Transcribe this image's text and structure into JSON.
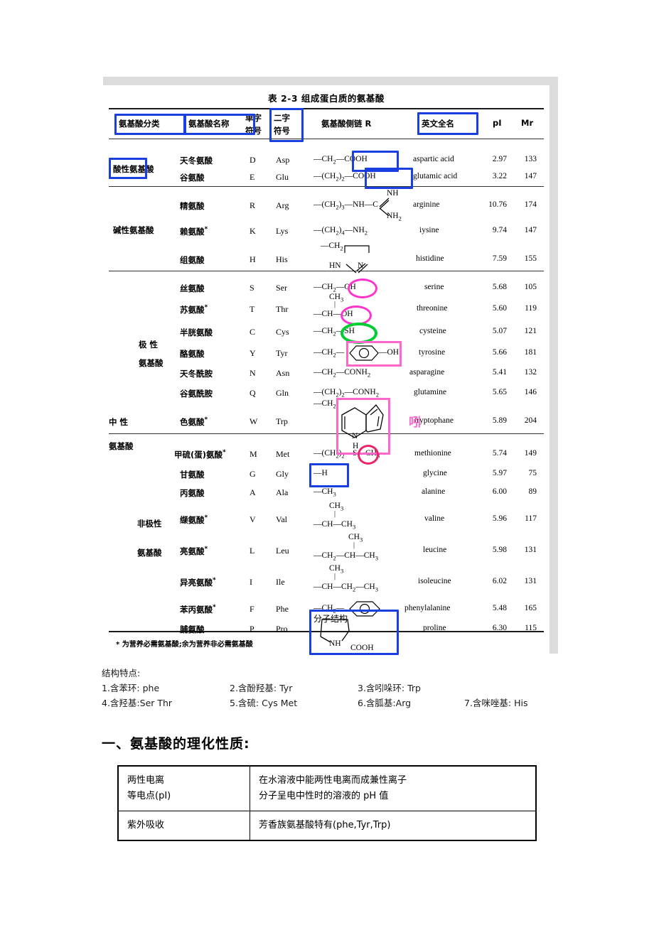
{
  "scan_table": {
    "title": "表 2-3   组成蛋白质的氨基酸",
    "headers": {
      "classification": "氨基酸分类",
      "name": "氨基酸名称",
      "one_letter_l1": "单字",
      "one_letter_l2": "符号",
      "three_letter_l1": "二字",
      "three_letter_l2": "符号",
      "side_chain": "氨基酸侧链 R",
      "english_name": "英文全名",
      "pi": "pI",
      "mr": "Mr"
    },
    "groups": {
      "acidic": "酸性氨基酸",
      "basic": "碱性氨基酸",
      "polar_l1": "极  性",
      "polar_l2": "氨基酸",
      "neutral_l1": "中  性",
      "neutral_l2": "氨基酸",
      "nonpolar_l1": "非极性",
      "nonpolar_l2": "氨基酸"
    },
    "rows": [
      {
        "name": "天冬氨酸",
        "essential": false,
        "one": "D",
        "three": "Asp",
        "english": "aspartic acid",
        "pi": "2.97",
        "mr": "133"
      },
      {
        "name": "谷氨酸",
        "essential": false,
        "one": "E",
        "three": "Glu",
        "english": "glutamic acid",
        "pi": "3.22",
        "mr": "147"
      },
      {
        "name": "精氨酸",
        "essential": false,
        "one": "R",
        "three": "Arg",
        "english": "arginine",
        "pi": "10.76",
        "mr": "174"
      },
      {
        "name": "赖氨酸",
        "essential": true,
        "one": "K",
        "three": "Lys",
        "english": "iysine",
        "pi": "9.74",
        "mr": "147"
      },
      {
        "name": "组氨酸",
        "essential": false,
        "one": "H",
        "three": "His",
        "english": "histidine",
        "pi": "7.59",
        "mr": "155"
      },
      {
        "name": "丝氨酸",
        "essential": false,
        "one": "S",
        "three": "Ser",
        "english": "serine",
        "pi": "5.68",
        "mr": "105"
      },
      {
        "name": "苏氨酸",
        "essential": true,
        "one": "T",
        "three": "Thr",
        "english": "threonine",
        "pi": "5.60",
        "mr": "119"
      },
      {
        "name": "半胱氨酸",
        "essential": false,
        "one": "C",
        "three": "Cys",
        "english": "cysteine",
        "pi": "5.07",
        "mr": "121"
      },
      {
        "name": "酪氨酸",
        "essential": false,
        "one": "Y",
        "three": "Tyr",
        "english": "tyrosine",
        "pi": "5.66",
        "mr": "181"
      },
      {
        "name": "天冬酰胺",
        "essential": false,
        "one": "N",
        "three": "Asn",
        "english": "asparagine",
        "pi": "5.41",
        "mr": "132"
      },
      {
        "name": "谷氨酰胺",
        "essential": false,
        "one": "Q",
        "three": "Gln",
        "english": "glutamine",
        "pi": "5.65",
        "mr": "146"
      },
      {
        "name": "色氨酸",
        "essential": true,
        "one": "W",
        "three": "Trp",
        "english": "tryptophane",
        "pi": "5.89",
        "mr": "204"
      },
      {
        "name": "甲硫(蛋)氨酸",
        "essential": true,
        "one": "M",
        "three": "Met",
        "english": "methionine",
        "pi": "5.74",
        "mr": "149"
      },
      {
        "name": "甘氨酸",
        "essential": false,
        "one": "G",
        "three": "Gly",
        "english": "glycine",
        "pi": "5.97",
        "mr": "75"
      },
      {
        "name": "丙氨酸",
        "essential": false,
        "one": "A",
        "three": "Ala",
        "english": "alanine",
        "pi": "6.00",
        "mr": "89"
      },
      {
        "name": "缬氨酸",
        "essential": true,
        "one": "V",
        "three": "Val",
        "english": "valine",
        "pi": "5.96",
        "mr": "117"
      },
      {
        "name": "亮氨酸",
        "essential": true,
        "one": "L",
        "three": "Leu",
        "english": "leucine",
        "pi": "5.98",
        "mr": "131"
      },
      {
        "name": "异亮氨酸",
        "essential": true,
        "one": "I",
        "three": "Ile",
        "english": "isoleucine",
        "pi": "6.02",
        "mr": "131"
      },
      {
        "name": "苯丙氨酸",
        "essential": true,
        "one": "F",
        "three": "Phe",
        "english": "phenylalanine",
        "pi": "5.48",
        "mr": "165"
      },
      {
        "name": "脯氨酸",
        "essential": false,
        "one": "P",
        "three": "Pro",
        "english": "proline",
        "pi": "6.30",
        "mr": "115"
      }
    ],
    "footnote": "* 为营养必需氨基酸;余为营养非必需氨基酸",
    "annotations": {
      "tryptophan_mark": "吲",
      "proline_box_label": "分子结构",
      "colors": {
        "blue_box": "#1a3fe0",
        "pink_box": "#ff66cc",
        "pink_ellipse": "#ff33cc",
        "green_ellipse": "#00cc33",
        "red_ellipse": "#e8256c"
      }
    }
  },
  "structure_notes": {
    "heading": "结构特点:",
    "items": [
      "1.含苯环:  phe",
      "2.含酚羟基: Tyr",
      "3.含吲哚环: Trp",
      "4.含羟基:Ser Thr",
      "5.含硫:   Cys Met",
      "6.含胍基:Arg",
      "7.含咪唑基: His"
    ]
  },
  "section": {
    "heading": "一、氨基酸的理化性质:"
  },
  "properties_table": {
    "rows": [
      {
        "key_line1": "两性电离",
        "key_line2": "等电点(pI)",
        "value_line1": "在水溶液中能两性电离而成兼性离子",
        "value_line2": "分子呈电中性时的溶液的 pH 值"
      },
      {
        "key_line1": "紫外吸收",
        "key_line2": "",
        "value_line1": "芳香族氨基酸特有(phe,Tyr,Trp)",
        "value_line2": ""
      }
    ]
  }
}
